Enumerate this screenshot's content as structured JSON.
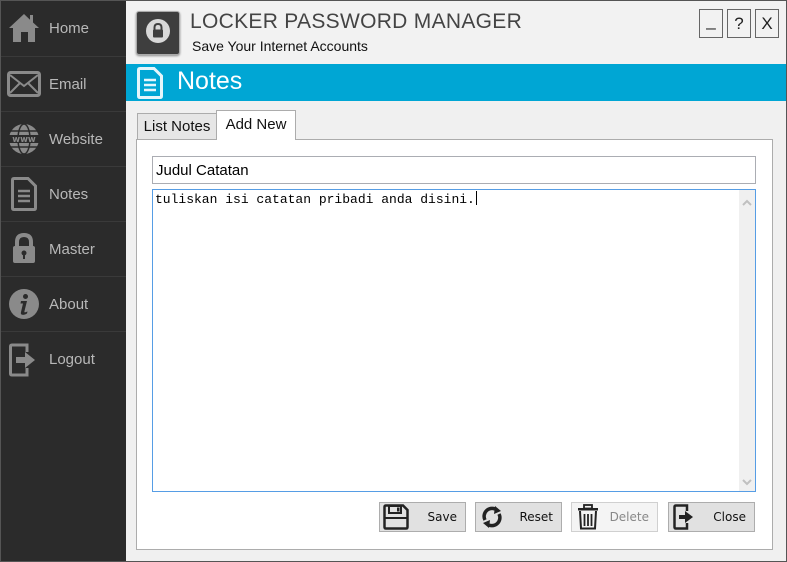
{
  "app": {
    "title": "LOCKER PASSWORD MANAGER",
    "subtitle": "Save Your Internet Accounts",
    "logo_icon": "lock-icon"
  },
  "window_controls": {
    "minimize": "_",
    "help": "?",
    "close": "X"
  },
  "sidebar": {
    "items": [
      {
        "label": "Home",
        "icon": "home-icon"
      },
      {
        "label": "Email",
        "icon": "envelope-icon"
      },
      {
        "label": "Website",
        "icon": "globe-www-icon"
      },
      {
        "label": "Notes",
        "icon": "document-icon"
      },
      {
        "label": "Master",
        "icon": "lock-icon"
      },
      {
        "label": "About",
        "icon": "info-icon"
      },
      {
        "label": "Logout",
        "icon": "logout-icon"
      }
    ]
  },
  "page": {
    "title": "Notes",
    "icon": "document-icon"
  },
  "tabs": [
    {
      "label": "List Notes",
      "active": false
    },
    {
      "label": "Add New",
      "active": true
    }
  ],
  "form": {
    "title_value": "Judul Catatan",
    "body_value": "tuliskan isi catatan pribadi anda disini."
  },
  "buttons": {
    "save": "Save",
    "reset": "Reset",
    "delete": "Delete",
    "close": "Close"
  },
  "colors": {
    "accent": "#00a6d4",
    "sidebar_bg": "#2b2b2b",
    "sidebar_text": "#b8b8b8"
  }
}
